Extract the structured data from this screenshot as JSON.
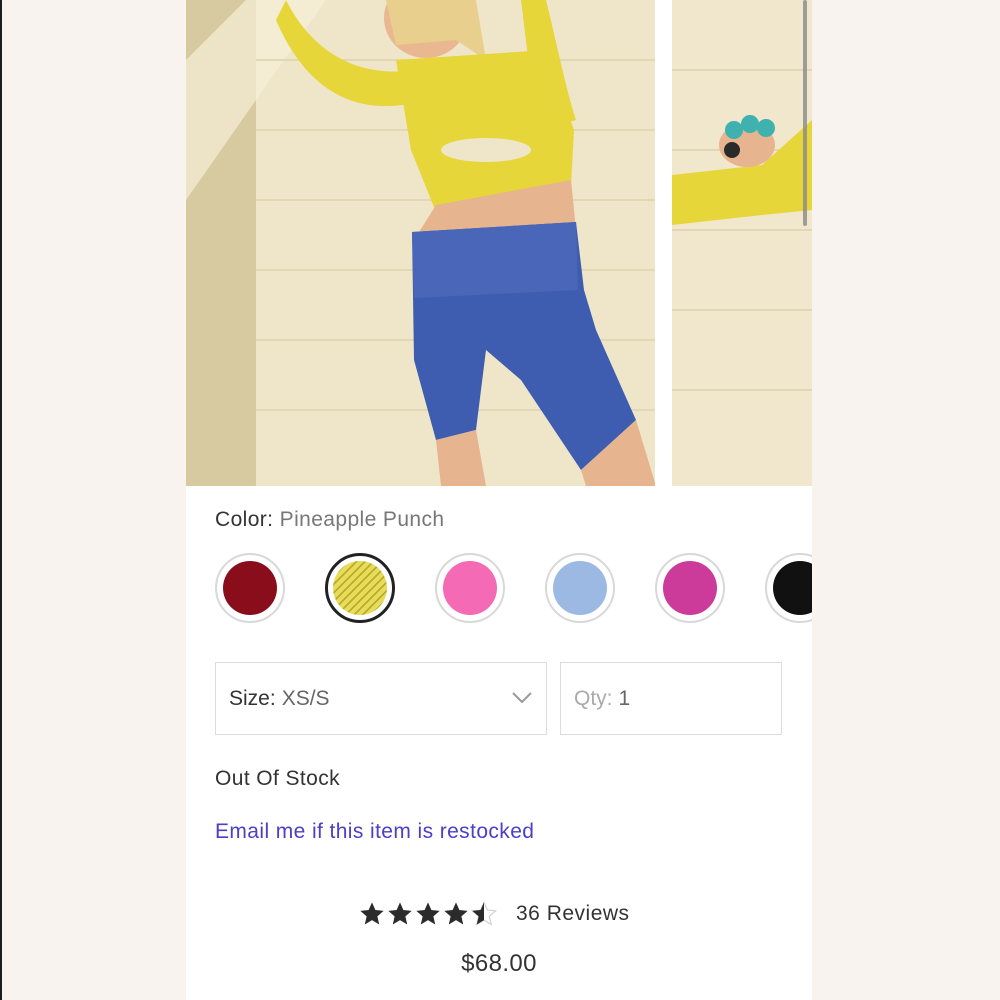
{
  "product": {
    "color_label": "Color:",
    "color_value": "Pineapple Punch",
    "swatches": [
      {
        "name": "burgundy",
        "color": "#8a0d1c"
      },
      {
        "name": "pineapple-punch",
        "color": "#e8dc5a",
        "selected": true
      },
      {
        "name": "pink",
        "color": "#f46ab4"
      },
      {
        "name": "light-blue",
        "color": "#9bb9e2"
      },
      {
        "name": "magenta",
        "color": "#cc3b9a"
      },
      {
        "name": "black",
        "color": "#111111"
      }
    ],
    "size_label": "Size:",
    "size_value": "XS/S",
    "qty_label": "Qty:",
    "qty_value": "1",
    "stock_status": "Out Of Stock",
    "restock_link": "Email me if this item is restocked",
    "rating": 4.5,
    "reviews": "36 Reviews",
    "price": "$68.00"
  },
  "colors": {
    "accent_link": "#4a3fc7",
    "selected_border": "#222222"
  }
}
